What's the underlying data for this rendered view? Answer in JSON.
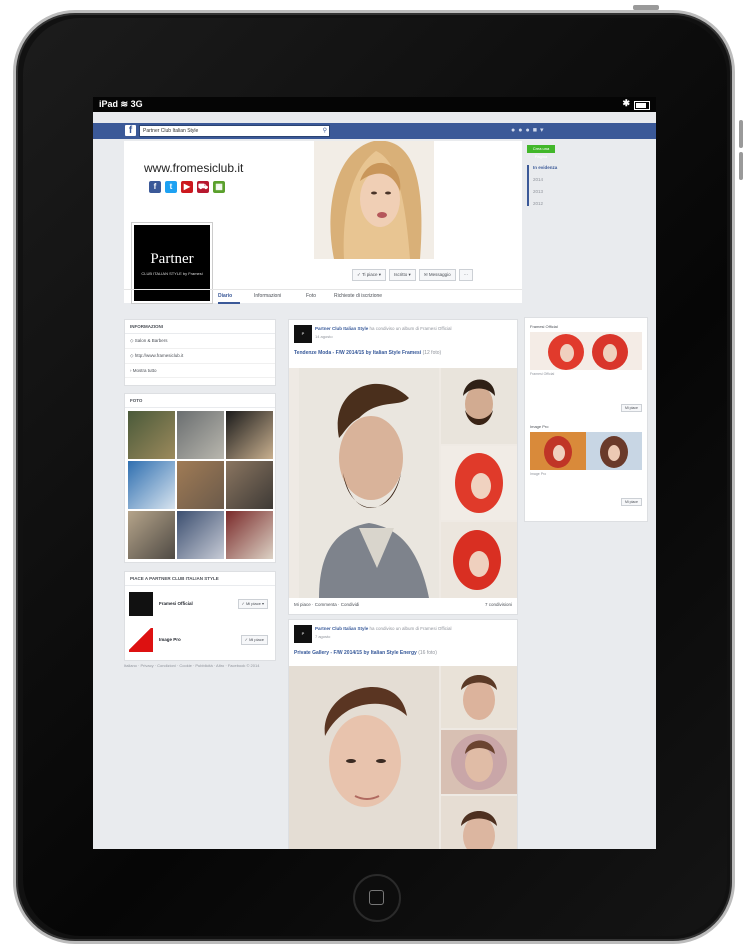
{
  "statusbar": {
    "device": "iPad",
    "network": "3G"
  },
  "search": {
    "value": "Partner Club Italian Style"
  },
  "cover": {
    "website": "www.fromesiclub.it",
    "profile_title": "Partner",
    "profile_subtitle": "CLUB ITALIAN STYLE by Framesi",
    "buttons": [
      "✓ Ti piace ▾",
      "Iscritto ▾",
      "✉ Messaggio",
      "···"
    ]
  },
  "social_icons": [
    "facebook-icon",
    "twitter-icon",
    "youtube-icon",
    "cart-icon",
    "wall-icon"
  ],
  "tabs": [
    {
      "label": "Diario",
      "active": true
    },
    {
      "label": "Informazioni",
      "active": false
    },
    {
      "label": "Foto",
      "active": false
    },
    {
      "label": "Richieste di iscrizione",
      "active": false
    }
  ],
  "right_rail": {
    "like_label": "Crea una Pagina",
    "years": [
      "In evidenza",
      "2014",
      "2013",
      "2012"
    ]
  },
  "info_card": {
    "header": "INFORMAZIONI",
    "rows": [
      "Salon & Barbers",
      "http://www.framesiclub.it",
      "Mostra tutto"
    ]
  },
  "photos_card": {
    "header": "FOTO"
  },
  "liked_card": {
    "header": "PIACE A PARTNER CLUB ITALIAN STYLE",
    "items": [
      {
        "name": "Framesi Official",
        "button": "✓ Mi piace ▾"
      },
      {
        "name": "Image Pro",
        "button": "✓ Mi piace"
      }
    ]
  },
  "footer_links": "Italiano · Privacy · Condizioni · Cookie · Pubblicità · Altro · Facebook © 2014",
  "posts": [
    {
      "author": "Partner Club Italian Style",
      "shared": "ha condiviso un album di Framesi Official",
      "time": "14 agosto",
      "title": "Tendenze Moda - F/W 2014/15 by Italian Style Framesi",
      "tag": "(12 foto)",
      "actions": "Mi piace · Commenta · Condividi",
      "share_count": "7 condivisioni"
    },
    {
      "author": "Partner Club Italian Style",
      "shared": "ha condiviso un album di Framesi Official",
      "time": "7 agosto",
      "title": "Private Gallery - F/W 2014/15 by Italian Style Energy",
      "tag": "(16 foto)"
    }
  ],
  "ads": [
    {
      "head": "Framesi Official",
      "caption": "Framesi Official",
      "button": "Mi piace"
    },
    {
      "head": "Image Pro",
      "caption": "Image Pro",
      "button": "Mi piace"
    }
  ]
}
